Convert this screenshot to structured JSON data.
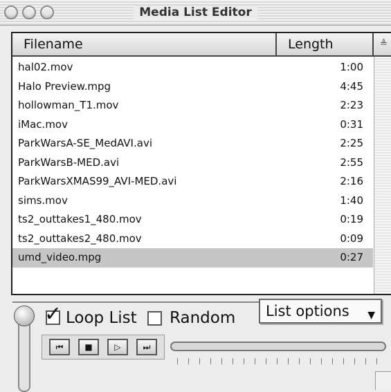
{
  "window": {
    "title": "Media List Editor"
  },
  "list": {
    "columns": {
      "filename": "Filename",
      "length": "Length"
    },
    "sort_icon": "≜",
    "rows": [
      {
        "filename": "hal02.mov",
        "length": "1:00"
      },
      {
        "filename": "Halo Preview.mpg",
        "length": "4:45"
      },
      {
        "filename": "hollowman_T1.mov",
        "length": "2:23"
      },
      {
        "filename": "iMac.mov",
        "length": "0:31"
      },
      {
        "filename": "ParkWarsA-SE_MedAVI.avi",
        "length": "2:25"
      },
      {
        "filename": "ParkWarsB-MED.avi",
        "length": "2:55"
      },
      {
        "filename": "ParkWarsXMAS99_AVI-MED.avi",
        "length": "2:16"
      },
      {
        "filename": "sims.mov",
        "length": "1:40"
      },
      {
        "filename": "ts2_outtakes1_480.mov",
        "length": "0:19"
      },
      {
        "filename": "ts2_outtakes2_480.mov",
        "length": "0:09"
      },
      {
        "filename": "umd_video.mpg",
        "length": "0:27"
      }
    ],
    "selected_row": "umd_video.mpg"
  },
  "controls": {
    "loop_list": {
      "label": "Loop List",
      "checked": true
    },
    "random": {
      "label": "Random",
      "checked": false
    },
    "list_options": {
      "label": "List options",
      "arrow": "▼"
    },
    "transport": [
      {
        "name": "previous-track-icon",
        "glyph": "⏮"
      },
      {
        "name": "stop-icon",
        "glyph": "■"
      },
      {
        "name": "play-icon",
        "glyph": "▷"
      },
      {
        "name": "next-track-icon",
        "glyph": "⏭"
      }
    ],
    "checkmark_glyph": "✓"
  }
}
